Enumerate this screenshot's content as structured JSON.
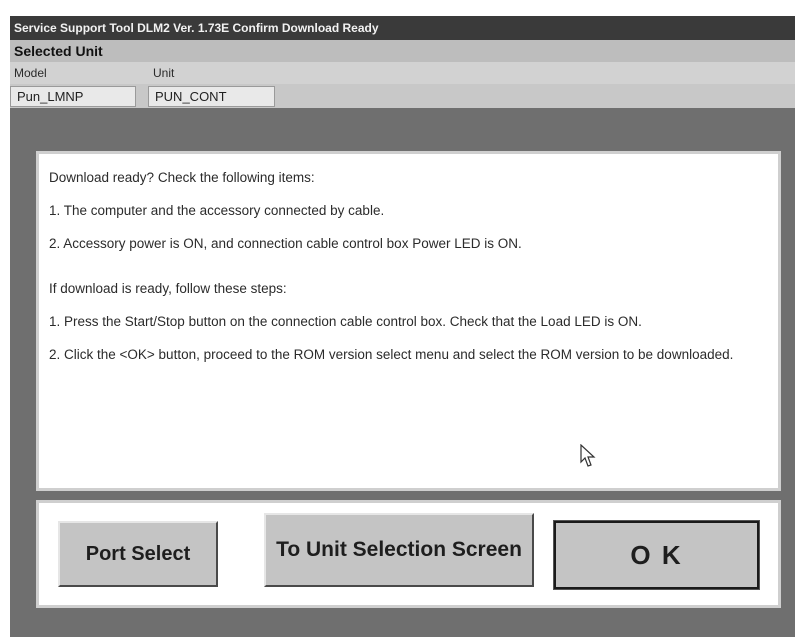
{
  "window": {
    "title": "Service Support Tool DLM2 Ver. 1.73E  Confirm Download Ready"
  },
  "selected_unit": {
    "header": "Selected Unit",
    "columns": [
      "Model",
      "Unit"
    ],
    "values": [
      "Pun_LMNP",
      "PUN_CONT"
    ]
  },
  "instructions": {
    "intro": "Download ready? Check the following items:",
    "check1": "1. The computer and the accessory connected by cable.",
    "check2": "2. Accessory power is ON, and connection cable control box Power LED is ON.",
    "steps_intro": "If download is ready, follow these steps:",
    "step1": "1. Press the Start/Stop button on the connection cable control box. Check that the Load LED is ON.",
    "step2": "2. Click the <OK> button, proceed to the ROM version select menu and select the ROM version to be downloaded."
  },
  "buttons": {
    "port_select": "Port Select",
    "unit_selection": "To Unit Selection Screen",
    "ok": "O K"
  }
}
